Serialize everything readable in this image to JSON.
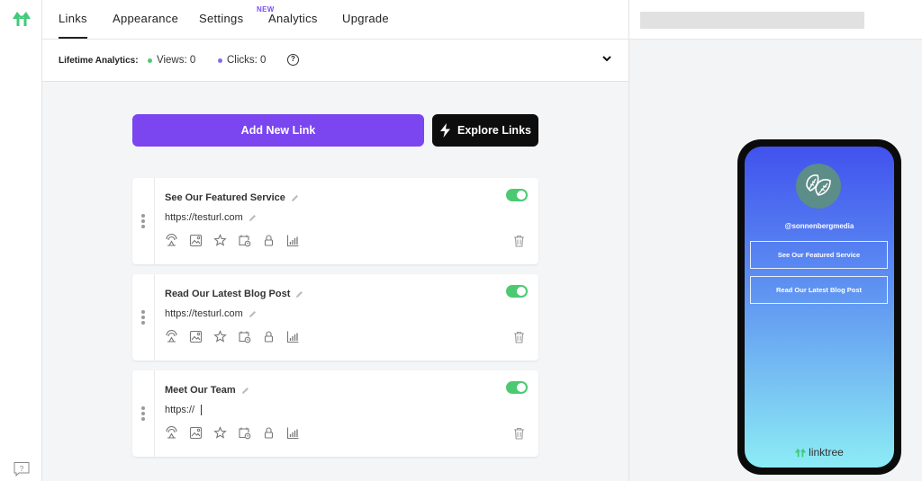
{
  "nav": {
    "tabs": [
      {
        "label": "Links",
        "active": true
      },
      {
        "label": "Appearance",
        "active": false
      },
      {
        "label": "Settings",
        "active": false
      },
      {
        "label": "Analytics",
        "active": false,
        "badge": "NEW"
      },
      {
        "label": "Upgrade",
        "active": false
      }
    ]
  },
  "analytics": {
    "label": "Lifetime Analytics:",
    "views": "Views: 0",
    "clicks": "Clicks: 0",
    "views_color": "#4cca72",
    "clicks_color": "#7b6ff0",
    "help_glyph": "?"
  },
  "actions": {
    "add_label": "Add New Link",
    "explore_label": "Explore Links"
  },
  "links": [
    {
      "title": "See Our Featured Service",
      "url": "https://testurl.com",
      "enabled": true
    },
    {
      "title": "Read Our Latest Blog Post",
      "url": "https://testurl.com",
      "enabled": true
    },
    {
      "title": "Meet Our Team",
      "url": "https://",
      "enabled": true
    }
  ],
  "preview": {
    "username": "@sonnenbergmedia",
    "buttons": [
      "See Our Featured Service",
      "Read Our Latest Blog Post"
    ],
    "footer_brand": "linktree"
  },
  "colors": {
    "accent": "#7b45f0",
    "brand_green": "#43c97a",
    "toggle_on": "#4cca72"
  }
}
